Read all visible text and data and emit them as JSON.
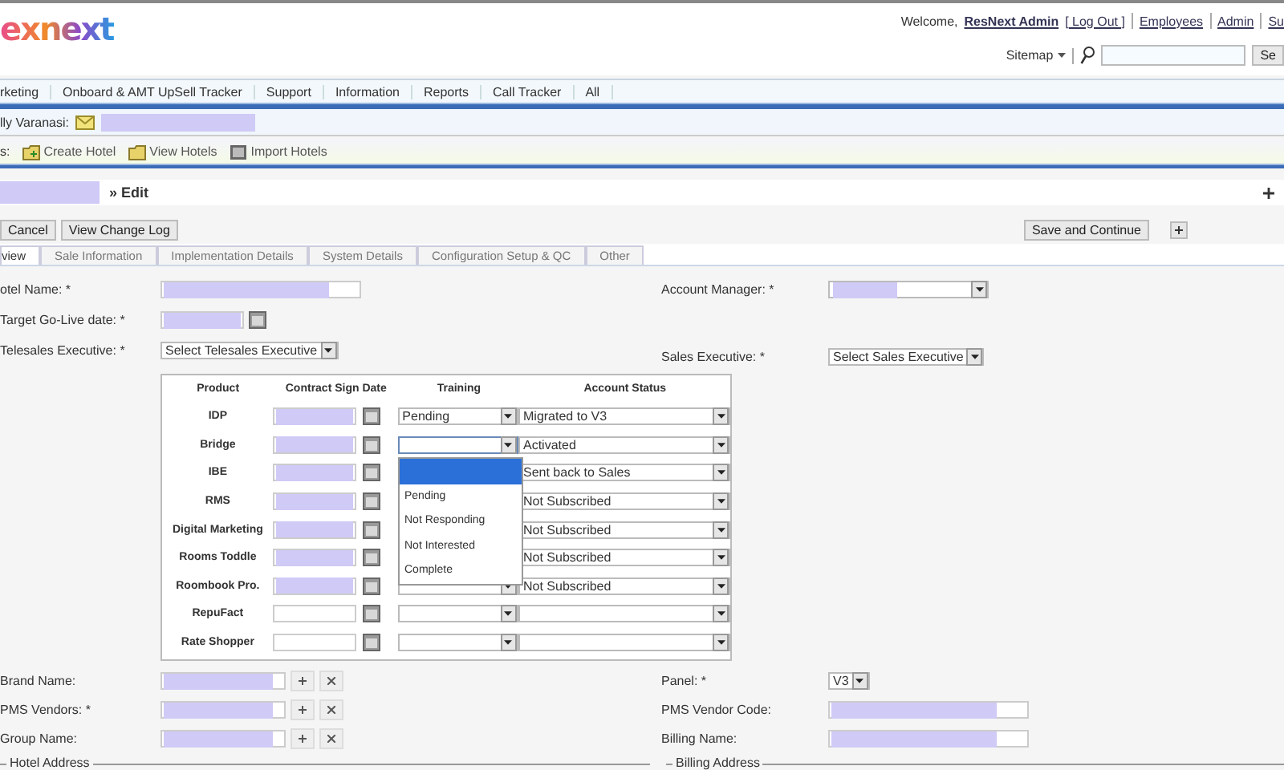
{
  "header": {
    "logo": "exnext",
    "welcome": "Welcome,",
    "user_link": "ResNext Admin",
    "logout": "[ Log Out ]",
    "top_links": [
      "Employees",
      "Admin",
      "Su"
    ],
    "sitemap": "Sitemap",
    "search_button": "Se"
  },
  "nav": [
    "rketing",
    "Onboard & AMT UpSell Tracker",
    "Support",
    "Information",
    "Reports",
    "Call Tracker",
    "All"
  ],
  "breadcrumb": {
    "label": "lly Varanasi:",
    "redacted": true
  },
  "toolbar": [
    {
      "label": "s:",
      "kind": "text"
    },
    {
      "label": "Create Hotel",
      "kind": "create"
    },
    {
      "label": "View Hotels",
      "kind": "view"
    },
    {
      "label": "Import Hotels",
      "kind": "import"
    }
  ],
  "page_title": {
    "redacted": true,
    "text": "» Edit"
  },
  "actions": {
    "left": [
      "Cancel",
      "View Change Log"
    ],
    "save": "Save and Continue"
  },
  "tabs": [
    {
      "label": "view",
      "selected": true
    },
    {
      "label": "Sale Information",
      "selected": false
    },
    {
      "label": "Implementation Details",
      "selected": false
    },
    {
      "label": "System Details",
      "selected": false
    },
    {
      "label": "Configuration Setup & QC",
      "selected": false
    },
    {
      "label": "Other",
      "selected": false
    }
  ],
  "left_fields": [
    {
      "label": "otel Name: *",
      "kind": "text",
      "redacted": true
    },
    {
      "label": "Target Go-Live date: *",
      "kind": "date",
      "redacted": true
    },
    {
      "label": "Telesales Executive: *",
      "kind": "select",
      "value": "Select Telesales Executive"
    }
  ],
  "right_fields": [
    {
      "label": "Account Manager: *",
      "kind": "select",
      "redacted": true
    },
    {
      "label": "Sales Executive: *",
      "kind": "select",
      "value": "Select Sales Executive"
    }
  ],
  "products": {
    "columns": [
      "Product",
      "Contract Sign Date",
      "Training",
      "Account Status"
    ],
    "rows": [
      {
        "product": "IDP",
        "date_redacted": true,
        "training": "Pending",
        "status": "Migrated to V3"
      },
      {
        "product": "Bridge",
        "date_redacted": true,
        "training_open": true,
        "status": "Activated"
      },
      {
        "product": "IBE",
        "date_redacted": true,
        "status": "Sent back to Sales"
      },
      {
        "product": "RMS",
        "date_redacted": true,
        "status": "Not Subscribed"
      },
      {
        "product": "Digital Marketing",
        "date_redacted": true,
        "status": "Not Subscribed"
      },
      {
        "product": "Rooms Toddle",
        "date_redacted": true,
        "status": "Not Subscribed"
      },
      {
        "product": "Roombook Pro.",
        "date_redacted": true,
        "status": "Not Subscribed"
      },
      {
        "product": "RepuFact",
        "date_redacted": false
      },
      {
        "product": "Rate Shopper",
        "date_redacted": false
      }
    ],
    "dropdown": [
      {
        "selected": true
      },
      {
        "label": "Pending",
        "selected": false
      },
      {
        "label": "Not Responding",
        "selected": false
      },
      {
        "label": "Not Interested",
        "selected": false
      },
      {
        "label": "Complete",
        "selected": false
      }
    ]
  },
  "lower_left": [
    {
      "label": "Brand Name:",
      "redacted": true
    },
    {
      "label": "PMS Vendors: *",
      "redacted": true
    },
    {
      "label": "Group Name:",
      "redacted": true
    }
  ],
  "lower_right": [
    {
      "label": "Panel: *",
      "kind": "select",
      "value": "V3"
    },
    {
      "label": "PMS Vendor Code:",
      "kind": "text",
      "redacted": true
    },
    {
      "label": "Billing Name:",
      "kind": "text",
      "redacted": true
    }
  ],
  "sections": [
    "Hotel Address",
    "Billing Address"
  ]
}
